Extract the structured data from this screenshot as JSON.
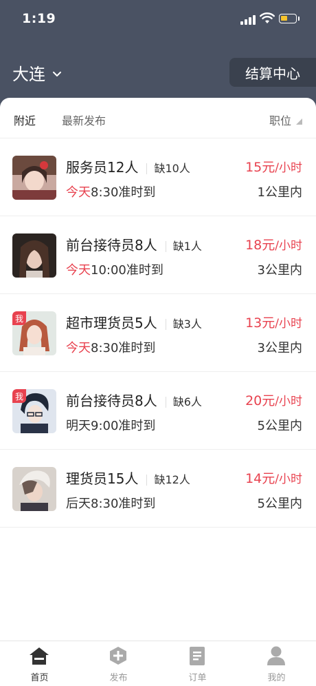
{
  "status_bar": {
    "time": "1:19"
  },
  "header": {
    "city": "大连",
    "settle_button": "结算中心"
  },
  "filters": {
    "nearby": "附近",
    "latest": "最新发布",
    "position": "职位"
  },
  "jobs": [
    {
      "title": "服务员12人",
      "shortage": "缺10人",
      "day": "今天",
      "day_highlight": true,
      "time": "8:30准时到",
      "wage": "15元",
      "unit": "/小时",
      "distance": "1公里内",
      "mine": false,
      "mine_label": ""
    },
    {
      "title": "前台接待员8人",
      "shortage": "缺1人",
      "day": "今天",
      "day_highlight": true,
      "time": "10:00准时到",
      "wage": "18元",
      "unit": "/小时",
      "distance": "3公里内",
      "mine": false,
      "mine_label": ""
    },
    {
      "title": "超市理货员5人",
      "shortage": "缺3人",
      "day": "今天",
      "day_highlight": true,
      "time": "8:30准时到",
      "wage": "13元",
      "unit": "/小时",
      "distance": "3公里内",
      "mine": true,
      "mine_label": "我"
    },
    {
      "title": "前台接待员8人",
      "shortage": "缺6人",
      "day": "明天",
      "day_highlight": false,
      "time": "9:00准时到",
      "wage": "20元",
      "unit": "/小时",
      "distance": "5公里内",
      "mine": true,
      "mine_label": "我"
    },
    {
      "title": "理货员15人",
      "shortage": "缺12人",
      "day": "后天",
      "day_highlight": false,
      "time": "8:30准时到",
      "wage": "14元",
      "unit": "/小时",
      "distance": "5公里内",
      "mine": false,
      "mine_label": ""
    }
  ],
  "tabbar": {
    "home": "首页",
    "publish": "发布",
    "orders": "订单",
    "mine": "我的"
  },
  "colors": {
    "header_bg": "#4a5263",
    "accent_red": "#e8424f"
  },
  "icons": [
    "signal-icon",
    "wifi-icon",
    "battery-icon",
    "chevron-down-icon",
    "home-icon",
    "plus-hexagon-icon",
    "clipboard-icon",
    "user-icon"
  ]
}
